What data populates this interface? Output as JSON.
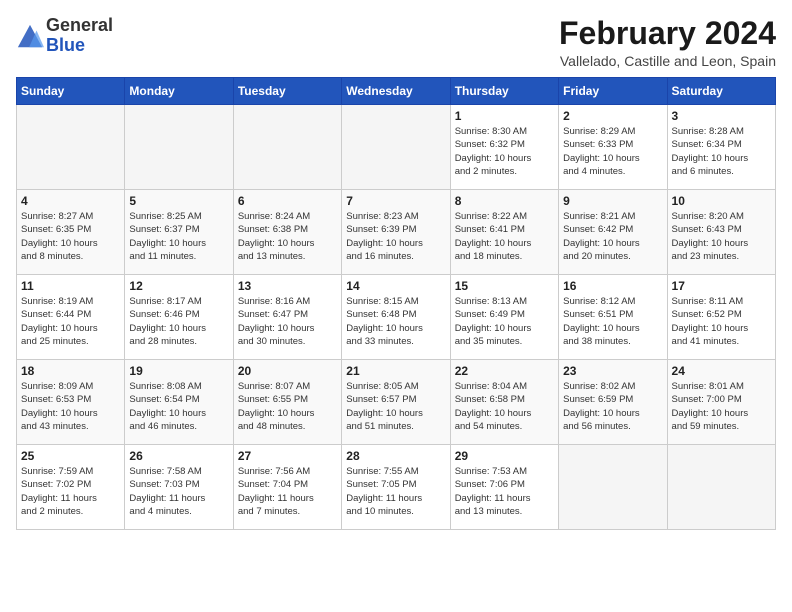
{
  "logo": {
    "general": "General",
    "blue": "Blue"
  },
  "title": "February 2024",
  "subtitle": "Vallelado, Castille and Leon, Spain",
  "headers": [
    "Sunday",
    "Monday",
    "Tuesday",
    "Wednesday",
    "Thursday",
    "Friday",
    "Saturday"
  ],
  "weeks": [
    [
      {
        "day": "",
        "info": ""
      },
      {
        "day": "",
        "info": ""
      },
      {
        "day": "",
        "info": ""
      },
      {
        "day": "",
        "info": ""
      },
      {
        "day": "1",
        "info": "Sunrise: 8:30 AM\nSunset: 6:32 PM\nDaylight: 10 hours\nand 2 minutes."
      },
      {
        "day": "2",
        "info": "Sunrise: 8:29 AM\nSunset: 6:33 PM\nDaylight: 10 hours\nand 4 minutes."
      },
      {
        "day": "3",
        "info": "Sunrise: 8:28 AM\nSunset: 6:34 PM\nDaylight: 10 hours\nand 6 minutes."
      }
    ],
    [
      {
        "day": "4",
        "info": "Sunrise: 8:27 AM\nSunset: 6:35 PM\nDaylight: 10 hours\nand 8 minutes."
      },
      {
        "day": "5",
        "info": "Sunrise: 8:25 AM\nSunset: 6:37 PM\nDaylight: 10 hours\nand 11 minutes."
      },
      {
        "day": "6",
        "info": "Sunrise: 8:24 AM\nSunset: 6:38 PM\nDaylight: 10 hours\nand 13 minutes."
      },
      {
        "day": "7",
        "info": "Sunrise: 8:23 AM\nSunset: 6:39 PM\nDaylight: 10 hours\nand 16 minutes."
      },
      {
        "day": "8",
        "info": "Sunrise: 8:22 AM\nSunset: 6:41 PM\nDaylight: 10 hours\nand 18 minutes."
      },
      {
        "day": "9",
        "info": "Sunrise: 8:21 AM\nSunset: 6:42 PM\nDaylight: 10 hours\nand 20 minutes."
      },
      {
        "day": "10",
        "info": "Sunrise: 8:20 AM\nSunset: 6:43 PM\nDaylight: 10 hours\nand 23 minutes."
      }
    ],
    [
      {
        "day": "11",
        "info": "Sunrise: 8:19 AM\nSunset: 6:44 PM\nDaylight: 10 hours\nand 25 minutes."
      },
      {
        "day": "12",
        "info": "Sunrise: 8:17 AM\nSunset: 6:46 PM\nDaylight: 10 hours\nand 28 minutes."
      },
      {
        "day": "13",
        "info": "Sunrise: 8:16 AM\nSunset: 6:47 PM\nDaylight: 10 hours\nand 30 minutes."
      },
      {
        "day": "14",
        "info": "Sunrise: 8:15 AM\nSunset: 6:48 PM\nDaylight: 10 hours\nand 33 minutes."
      },
      {
        "day": "15",
        "info": "Sunrise: 8:13 AM\nSunset: 6:49 PM\nDaylight: 10 hours\nand 35 minutes."
      },
      {
        "day": "16",
        "info": "Sunrise: 8:12 AM\nSunset: 6:51 PM\nDaylight: 10 hours\nand 38 minutes."
      },
      {
        "day": "17",
        "info": "Sunrise: 8:11 AM\nSunset: 6:52 PM\nDaylight: 10 hours\nand 41 minutes."
      }
    ],
    [
      {
        "day": "18",
        "info": "Sunrise: 8:09 AM\nSunset: 6:53 PM\nDaylight: 10 hours\nand 43 minutes."
      },
      {
        "day": "19",
        "info": "Sunrise: 8:08 AM\nSunset: 6:54 PM\nDaylight: 10 hours\nand 46 minutes."
      },
      {
        "day": "20",
        "info": "Sunrise: 8:07 AM\nSunset: 6:55 PM\nDaylight: 10 hours\nand 48 minutes."
      },
      {
        "day": "21",
        "info": "Sunrise: 8:05 AM\nSunset: 6:57 PM\nDaylight: 10 hours\nand 51 minutes."
      },
      {
        "day": "22",
        "info": "Sunrise: 8:04 AM\nSunset: 6:58 PM\nDaylight: 10 hours\nand 54 minutes."
      },
      {
        "day": "23",
        "info": "Sunrise: 8:02 AM\nSunset: 6:59 PM\nDaylight: 10 hours\nand 56 minutes."
      },
      {
        "day": "24",
        "info": "Sunrise: 8:01 AM\nSunset: 7:00 PM\nDaylight: 10 hours\nand 59 minutes."
      }
    ],
    [
      {
        "day": "25",
        "info": "Sunrise: 7:59 AM\nSunset: 7:02 PM\nDaylight: 11 hours\nand 2 minutes."
      },
      {
        "day": "26",
        "info": "Sunrise: 7:58 AM\nSunset: 7:03 PM\nDaylight: 11 hours\nand 4 minutes."
      },
      {
        "day": "27",
        "info": "Sunrise: 7:56 AM\nSunset: 7:04 PM\nDaylight: 11 hours\nand 7 minutes."
      },
      {
        "day": "28",
        "info": "Sunrise: 7:55 AM\nSunset: 7:05 PM\nDaylight: 11 hours\nand 10 minutes."
      },
      {
        "day": "29",
        "info": "Sunrise: 7:53 AM\nSunset: 7:06 PM\nDaylight: 11 hours\nand 13 minutes."
      },
      {
        "day": "",
        "info": ""
      },
      {
        "day": "",
        "info": ""
      }
    ]
  ]
}
